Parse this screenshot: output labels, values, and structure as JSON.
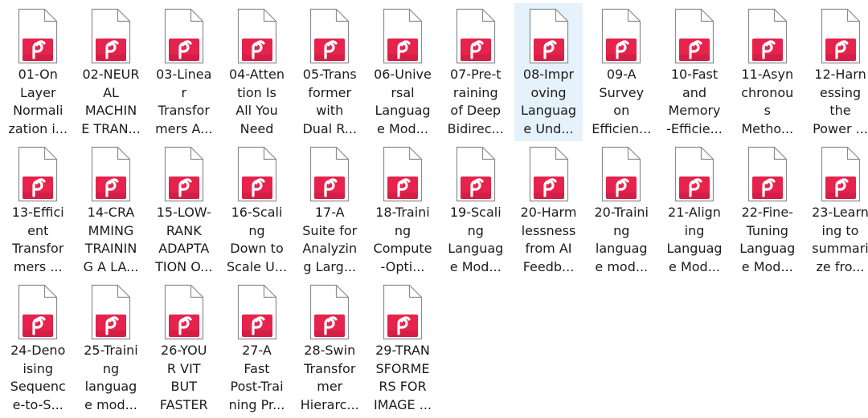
{
  "icon": "pdf-document-icon",
  "colors": {
    "accent": "#e5234d",
    "accent_dark": "#b8163a",
    "page_fill": "#ffffff",
    "page_stroke": "#8c8c8c",
    "selection": "#e5f1fb",
    "text": "#1b1b1b"
  },
  "files": [
    {
      "label": "01-On\nLayer\nNormali\nzation i...",
      "selected": false
    },
    {
      "label": "02-NEUR\nAL\nMACHIN\nE TRAN...",
      "selected": false
    },
    {
      "label": "03-Linea\nr\nTransfor\nmers A...",
      "selected": false
    },
    {
      "label": "04-Atten\ntion Is\nAll You\nNeed",
      "selected": false
    },
    {
      "label": "05-Trans\nformer\nwith\nDual R...",
      "selected": false
    },
    {
      "label": "06-Unive\nrsal\nLanguag\ne Mod...",
      "selected": false
    },
    {
      "label": "07-Pre-t\nraining\nof Deep\nBidirec...",
      "selected": false
    },
    {
      "label": "08-Impr\noving\nLanguag\ne Und...",
      "selected": true
    },
    {
      "label": "09-A\nSurvey\non\nEfficien...",
      "selected": false
    },
    {
      "label": "10-Fast\nand\nMemory\n-Efficie...",
      "selected": false
    },
    {
      "label": "11-Asyn\nchronou\ns\nMetho...",
      "selected": false
    },
    {
      "label": "12-Harn\nessing\nthe\nPower ...",
      "selected": false
    },
    {
      "label": "13-Effici\nent\nTransfor\nmers ...",
      "selected": false
    },
    {
      "label": "14-CRA\nMMING\nTRAININ\nG A LA...",
      "selected": false
    },
    {
      "label": "15-LOW-\nRANK\nADAPTA\nTION O...",
      "selected": false
    },
    {
      "label": "16-Scali\nng\nDown to\nScale U...",
      "selected": false
    },
    {
      "label": "17-A\nSuite for\nAnalyzin\ng Larg...",
      "selected": false
    },
    {
      "label": "18-Traini\nng\nCompute\n-Opti...",
      "selected": false
    },
    {
      "label": "19-Scali\nng\nLanguag\ne Mod...",
      "selected": false
    },
    {
      "label": "20-Harm\nlessness\nfrom AI\nFeedb...",
      "selected": false
    },
    {
      "label": "20-Traini\nng\nlanguag\ne mod...",
      "selected": false
    },
    {
      "label": "21-Align\ning\nLanguag\ne Mod...",
      "selected": false
    },
    {
      "label": "22-Fine-\nTuning\nLanguag\ne Mod...",
      "selected": false
    },
    {
      "label": "23-Learn\ning to\nsummari\nze fro...",
      "selected": false
    },
    {
      "label": "24-Deno\nising\nSequenc\ne-to-S...",
      "selected": false
    },
    {
      "label": "25-Traini\nng\nlanguag\ne mod...",
      "selected": false
    },
    {
      "label": "26-YOU\nR VIT\nBUT\nFASTER",
      "selected": false
    },
    {
      "label": "27-A\nFast\nPost-Trai\nning Pr...",
      "selected": false
    },
    {
      "label": "28-Swin\nTransfor\nmer\nHierarc...",
      "selected": false
    },
    {
      "label": "29-TRAN\nSFORME\nRS FOR\nIMAGE ...",
      "selected": false
    }
  ]
}
